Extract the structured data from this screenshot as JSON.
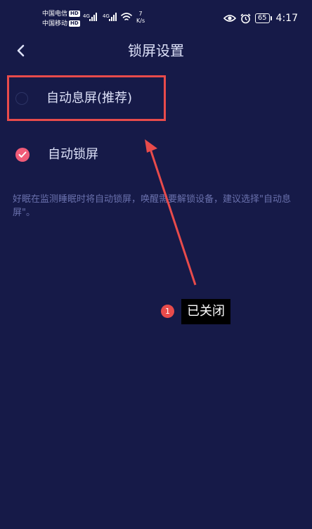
{
  "status_bar": {
    "carrier_1": "中国电信",
    "carrier_2": "中国移动",
    "hd_badge": "HD",
    "net_1": "4G",
    "net_2": "4G",
    "speed_value": "7",
    "speed_unit": "K/s",
    "battery": "65",
    "time": "4:17"
  },
  "header": {
    "title": "锁屏设置"
  },
  "options": [
    {
      "label": "自动息屏(推荐)",
      "selected": false
    },
    {
      "label": "自动锁屏",
      "selected": true
    }
  ],
  "hint": "好眠在监测睡眠时将自动锁屏，唤醒需要解锁设备，建议选择\"自动息屏\"。",
  "annotation": {
    "step_number": "1",
    "step_label": "已关闭",
    "color": "#e84b4b"
  },
  "colors": {
    "background": "#161a48",
    "accent": "#f05b78",
    "hint_text": "#6a71ad"
  }
}
